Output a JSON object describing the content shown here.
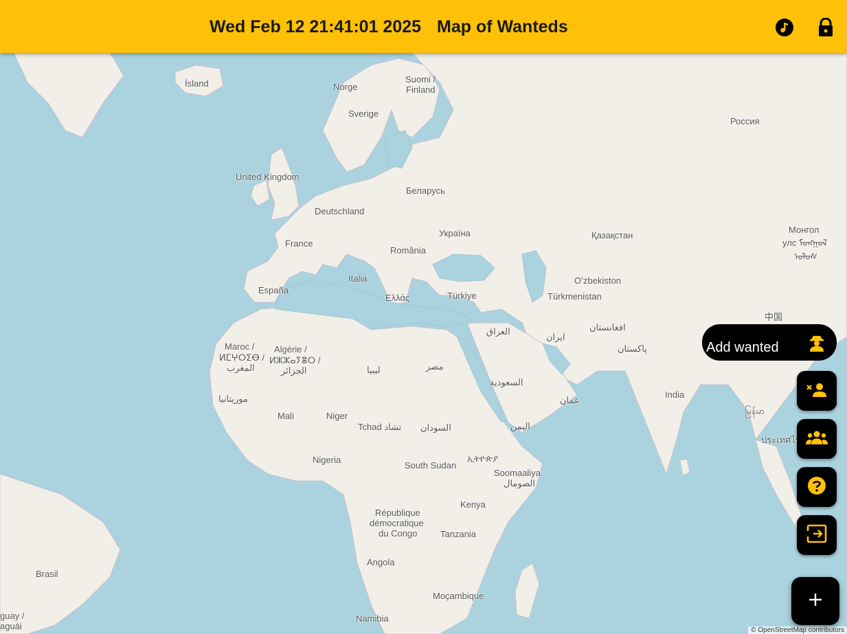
{
  "header": {
    "datetime": "Wed Feb 12 21:41:01 2025",
    "title": "Map of Wanteds",
    "icons": [
      "music-note-icon",
      "lock-icon"
    ],
    "background": "#ffc107"
  },
  "map": {
    "land_color": "#f2efe9",
    "water_color": "#aad3df",
    "labels": [
      "Ísland",
      "Norge",
      "Suomi /",
      "Finland",
      "Sverige",
      "Россия",
      "United Kingdom",
      "Беларусь",
      "Deutschland",
      "Україна",
      "France",
      "România",
      "Қазақстан",
      "Монгол",
      "улс ᠮᠣᠩᠭᠣᠯ",
      "ᠤᠯᠤᠰ",
      "España",
      "Italia",
      "Ελλάς",
      "Türkiye",
      "Oʻzbekiston",
      "Türkmenistan",
      "中国",
      "Maroc /",
      "ⵍⵎⵖⵔⵉⴱ /",
      "المغرب",
      "Algérie /",
      "ⵍⵣⵣⴰⵢⴻⵔ /",
      "الجزائر",
      "العراق",
      "ایران",
      "افغانستان",
      "پاکستان",
      "ليبيا",
      "مصر",
      "السعودية",
      "موريتانيا",
      "Mali",
      "Niger",
      "Tchad تشاد",
      "السودان",
      "اليمن",
      "عمان",
      "India",
      "မြန်မာ",
      "ประเทศไท",
      "Nigeria",
      "South Sudan",
      "ኢትዮጵያ",
      "Soomaaliya",
      "الصومال",
      "Kenya",
      "République",
      "démocratique",
      "du Congo",
      "Tanzania",
      "Angola",
      "Brasil",
      "Moçambique",
      "Namibia",
      "guay /",
      "aguái"
    ],
    "attribution": "© OpenStreetMap contributors"
  },
  "actions": {
    "add_wanted_label": "Add  wanted",
    "buttons": [
      "add-wanted-icon",
      "person-remove-icon",
      "group-icon",
      "help-icon",
      "exit-icon",
      "add-icon"
    ],
    "accent_color": "#ffc107"
  }
}
